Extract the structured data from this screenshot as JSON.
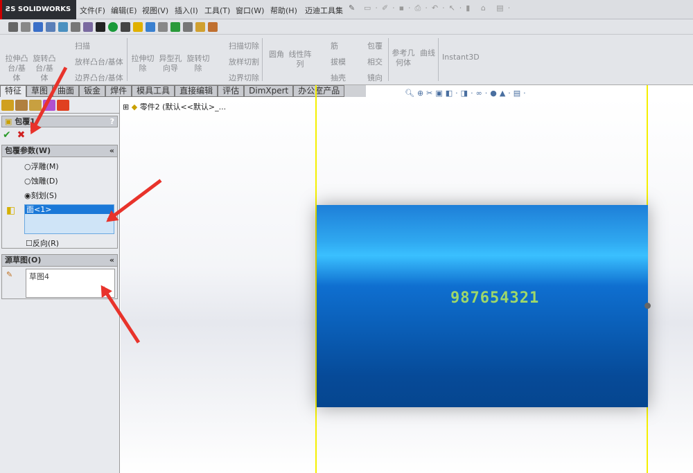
{
  "app": {
    "logo": "SOLIDWORKS"
  },
  "menu": [
    "文件(F)",
    "编辑(E)",
    "视图(V)",
    "插入(I)",
    "工具(T)",
    "窗口(W)",
    "帮助(H)",
    "迈迪工具集"
  ],
  "ribbon": {
    "extrude_boss": "拉伸凸台/基体",
    "revolve_boss": "旋转凸台/基体",
    "sweep": "扫描",
    "loft": "放样凸台/基体",
    "boundary": "边界凸台/基体",
    "extrude_cut": "拉伸切除",
    "hole_wizard": "异型孔向导",
    "revolve_cut": "旋转切除",
    "sweep_cut": "扫描切除",
    "loft_cut": "放样切割",
    "boundary_cut": "边界切除",
    "fillet": "圆角",
    "linear_pattern": "线性阵列",
    "rib": "筋",
    "draft": "拔模",
    "shell": "抽壳",
    "wrap": "包覆",
    "intersect": "相交",
    "mirror": "镜向",
    "ref_geometry": "参考几何体",
    "curves": "曲线",
    "instant3d": "Instant3D"
  },
  "tabs": [
    "特征",
    "草图",
    "曲面",
    "钣金",
    "焊件",
    "模具工具",
    "直接编辑",
    "评估",
    "DimXpert",
    "办公室产品"
  ],
  "panel": {
    "title": "包覆1",
    "help": "?",
    "params": {
      "header": "包覆参数(W)",
      "emboss": "浮雕(M)",
      "deboss": "蚀雕(D)",
      "scribe": "刻划(S)",
      "selected": "scribe",
      "face": "面<1>",
      "reverse": "反向(R)",
      "reverse_checked": false
    },
    "source": {
      "header": "源草图(O)",
      "sketch": "草图4"
    }
  },
  "tree": {
    "root": "零件2  (默认<<默认>_..."
  },
  "model": {
    "wrap_text": "987654321"
  }
}
